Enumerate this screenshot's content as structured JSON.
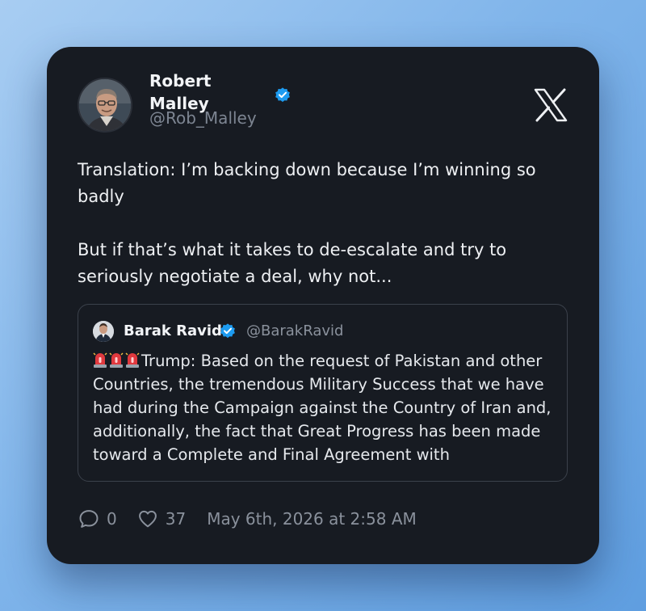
{
  "author": {
    "name": "Robert Malley",
    "handle": "@Rob_Malley"
  },
  "tweet": {
    "text": "Translation: I’m backing down because I’m winning so badly\n\nBut if that’s what it takes to de-escalate and try to seriously negotiate a deal, why not..."
  },
  "quoted_tweet": {
    "name": "Barak Ravid",
    "handle": "@BarakRavid",
    "emoji_icons": [
      "rotating-light-icon",
      "rotating-light-icon",
      "rotating-light-icon"
    ],
    "text": "Trump: Based on the request of Pakistan and other Countries, the tremendous Military Success that we have had during the Campaign against the Country of Iran and, additionally, the fact that Great Progress has been made toward a Complete and Final Agreement with"
  },
  "stats": {
    "replies": "0",
    "likes": "37",
    "timestamp": "May 6th, 2026 at 2:58 AM"
  },
  "icons": {
    "verified": "verified-badge-icon",
    "logo": "x-logo-icon",
    "reply": "reply-icon",
    "like": "heart-icon"
  },
  "colors": {
    "card_background": "#171b22",
    "verified_blue": "#1d9bf0",
    "text_primary": "#eef0f3",
    "text_secondary": "#8a919c"
  }
}
